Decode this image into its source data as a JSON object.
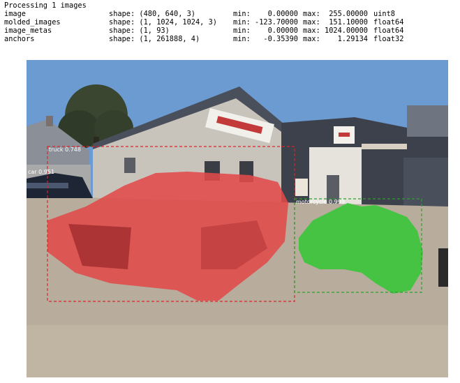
{
  "log": {
    "header": "Processing 1 images",
    "rows": [
      {
        "name": "image",
        "shape": "shape: (480, 640, 3)",
        "min": "min:    0.00000",
        "max": "max:  255.00000",
        "dtype": "uint8"
      },
      {
        "name": "molded_images",
        "shape": "shape: (1, 1024, 1024, 3)",
        "min": "min: -123.70000",
        "max": "max:  151.10000",
        "dtype": "float64"
      },
      {
        "name": "image_metas",
        "shape": "shape: (1, 93)",
        "min": "min:    0.00000",
        "max": "max: 1024.00000",
        "dtype": "float64"
      },
      {
        "name": "anchors",
        "shape": "shape: (1, 261888, 4)",
        "min": "min:   -0.35390",
        "max": "max:    1.29134",
        "dtype": "float32"
      }
    ]
  },
  "detections": [
    {
      "label": "truck 0.748",
      "color": "#d62728"
    },
    {
      "label": "car 0.951",
      "color": "#1f77b4"
    },
    {
      "label": "motorcycle 0.999",
      "color": "#2ca02c"
    }
  ],
  "colors": {
    "sky": "#6b9bd0",
    "building": "#c9c4bb",
    "roof": "#4a4f5c",
    "ground": "#b8ad9c",
    "truck_mask": "#e04a4a",
    "motorcycle_mask": "#3cc43c",
    "truck_box": "#d62728",
    "motorcycle_box": "#2ca02c"
  }
}
